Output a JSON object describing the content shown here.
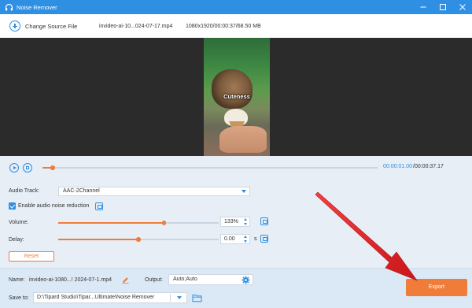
{
  "app": {
    "title": "Noise Remover"
  },
  "toolbar": {
    "change_source_label": "Change Source File",
    "file_name": "invideo-ai-10...024-07-17.mp4",
    "file_meta": "1080x1920/00:00:37/68.50 MB"
  },
  "video": {
    "caption": "Cuteness"
  },
  "playback": {
    "current_time": "00:00:01.00",
    "total_time": "/00:00:37.17",
    "progress_fraction": 0.03
  },
  "settings": {
    "audio_track_label": "Audio Track:",
    "audio_track_value": "AAC-2Channel",
    "noise_reduction_label": "Enable audio noise reduction",
    "noise_reduction_checked": true,
    "volume_label": "Volume:",
    "volume_value": "133%",
    "volume_fraction": 0.66,
    "delay_label": "Delay:",
    "delay_value": "0.00",
    "delay_unit": "s",
    "delay_fraction": 0.5,
    "reset_label": "Reset"
  },
  "footer": {
    "name_label": "Name:",
    "name_value": "invideo-ai-1080...! 2024-07-1.mp4",
    "output_label": "Output:",
    "output_value": "Auto;Auto",
    "save_to_label": "Save to:",
    "save_to_value": "D:\\Tipard Studio\\Tipar...Ultimate\\Noise Remover",
    "export_label": "Export"
  },
  "colors": {
    "accent": "#2f8fe3",
    "orange": "#f07c3a",
    "annotation_arrow": "#e8262a"
  }
}
